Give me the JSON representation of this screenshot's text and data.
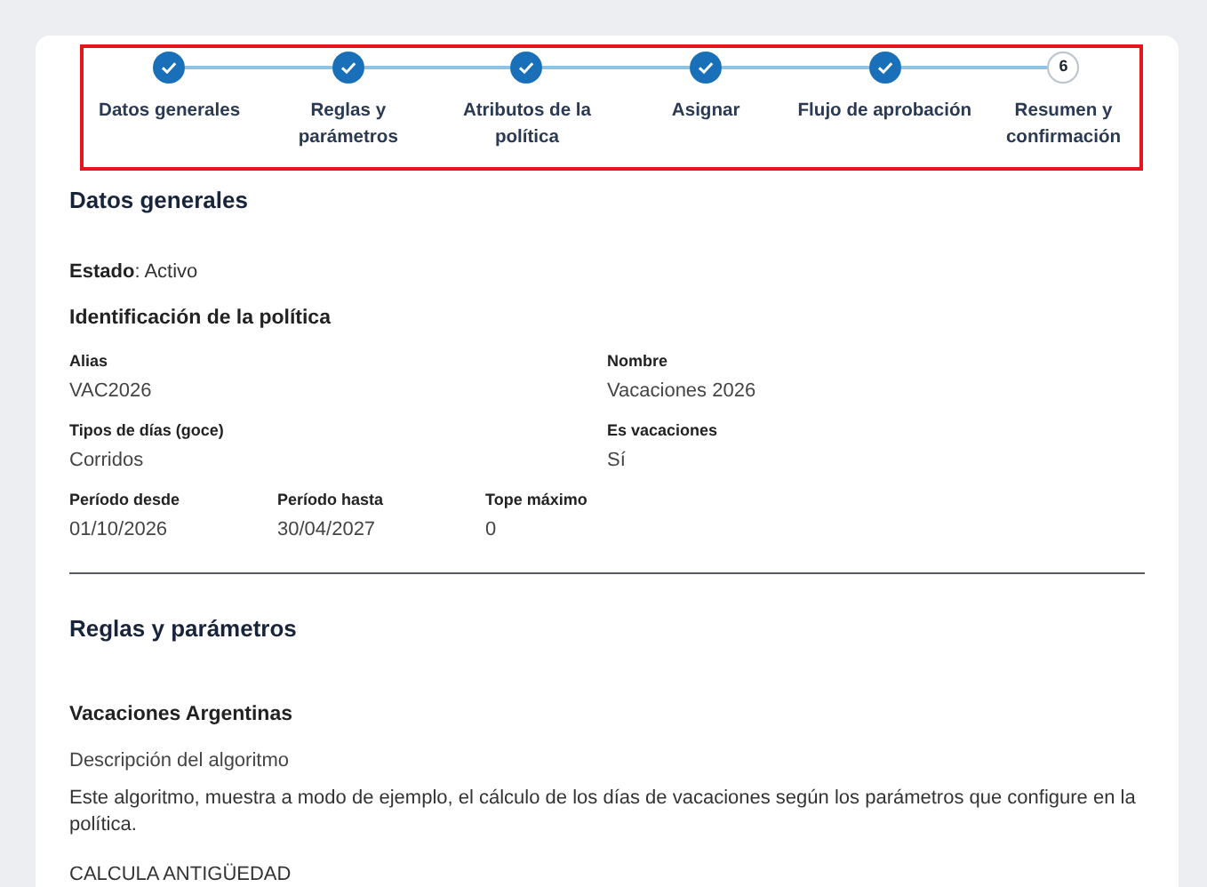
{
  "stepper": {
    "steps": [
      {
        "label": "Datos generales",
        "completed": true
      },
      {
        "label": "Reglas y parámetros",
        "completed": true
      },
      {
        "label": "Atributos de la política",
        "completed": true
      },
      {
        "label": "Asignar",
        "completed": true
      },
      {
        "label": "Flujo de aprobación",
        "completed": true
      },
      {
        "label": "Resumen y confirmación",
        "completed": false,
        "number": "6"
      }
    ]
  },
  "general": {
    "title": "Datos generales",
    "status_label": "Estado",
    "status_value": ": Activo",
    "subtitle": "Identificación de la política",
    "rows": [
      [
        {
          "label": "Alias",
          "value": "VAC2026"
        },
        {
          "label": "Nombre",
          "value": "Vacaciones 2026"
        }
      ],
      [
        {
          "label": "Tipos de días (goce)",
          "value": "Corridos"
        },
        {
          "label": "Es vacaciones",
          "value": "Sí"
        }
      ],
      [
        {
          "label": "Período desde",
          "value": "01/10/2026"
        },
        {
          "label": "Período hasta",
          "value": "30/04/2027"
        },
        {
          "label": "Tope máximo",
          "value": "0"
        }
      ]
    ]
  },
  "rules": {
    "title": "Reglas y parámetros",
    "algorithm_name": "Vacaciones Argentinas",
    "description_label": "Descripción del algoritmo",
    "description": "Este algoritmo, muestra a modo de ejemplo, el cálculo de los días de vacaciones  según los parámetros que configure en la política.",
    "next_heading": "CALCULA ANTIGÜEDAD"
  }
}
